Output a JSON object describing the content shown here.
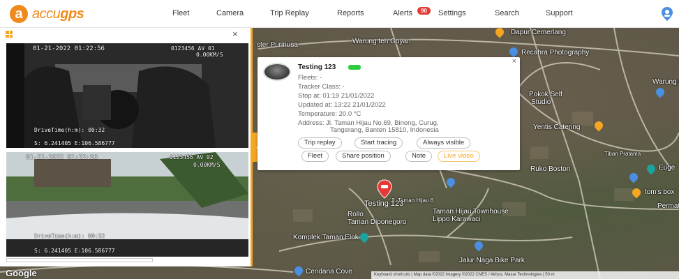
{
  "nav": {
    "logo_letter": "a",
    "logo_text_prefix": "accu",
    "logo_text_suffix": "gps",
    "items": [
      {
        "label": "Fleet"
      },
      {
        "label": "Camera"
      },
      {
        "label": "Trip Replay"
      },
      {
        "label": "Reports"
      },
      {
        "label": "Alerts"
      },
      {
        "label": "Settings"
      },
      {
        "label": "Search"
      },
      {
        "label": "Support"
      }
    ],
    "alerts_count": "90"
  },
  "camera_panel": {
    "feeds": [
      {
        "datetime": "01-21-2022 01:22:56",
        "device": "0123456 AV 01",
        "speed": "0.00KM/S",
        "drive_time": "DriveTime(h:m): 00:32",
        "coords": "S:  6.241405 E:106.586777"
      },
      {
        "datetime": "01-21-2022 01:22:56",
        "device": "0123456 AV 02",
        "speed": "0.00KM/S",
        "drive_time": "DriveTime(h:m): 00:32",
        "coords": "S:  6.241405 E:106.586777"
      }
    ],
    "close_glyph": "×",
    "collapse_glyph": "‹"
  },
  "popup": {
    "title": "Testing 123",
    "status_color": "#2ecc40",
    "fleets": "Fleets: -",
    "tracker_class": "Tracker Class: -",
    "stop_at": "Stop at: 01:19 21/01/2022",
    "updated_at": "Updated at: 13:22 21/01/2022",
    "temperature": "Temperature: 20.0 °C",
    "address_line1": "Address: Jl. Taman Hijau No.69, Binong, Curug,",
    "address_line2": "Tangerang, Banten 15810, Indonesia",
    "buttons_row1": [
      "Trip replay",
      "Start tracing",
      "Always visible"
    ],
    "buttons_row2": [
      "Fleet",
      "Share position",
      "Note",
      "Live video"
    ],
    "close_glyph": "×"
  },
  "map": {
    "labels": [
      "Dapur Cemerlang",
      "Warung teh Goyan",
      "Recahra Photography",
      "ster Purinusa",
      "Pokok Self",
      "Studio",
      "Warung e",
      "Yentis Catering",
      "Ruko Boston",
      "Euge",
      "tom's box",
      "Permata",
      "Rollo",
      "Taman Diponegoro",
      "Taman Hijau Townhouse",
      "Lippo Karawaci",
      "Komplek Taman Elok",
      "Jalur Naga Bike Park",
      "Cendana Cove",
      "Tiban Pratama",
      "Jl. Taman Hijau 6"
    ],
    "marker_label": "Testing 123",
    "google": "Google",
    "attribution": "Keyboard shortcuts | Map data ©2022 Imagery ©2022 CNES / Airbus, Maxar Technologies | 50 m"
  },
  "colors": {
    "accent": "#f5a623",
    "brand": "#f08a1c",
    "alert_badge": "#e53935",
    "marker": "#e53935"
  }
}
